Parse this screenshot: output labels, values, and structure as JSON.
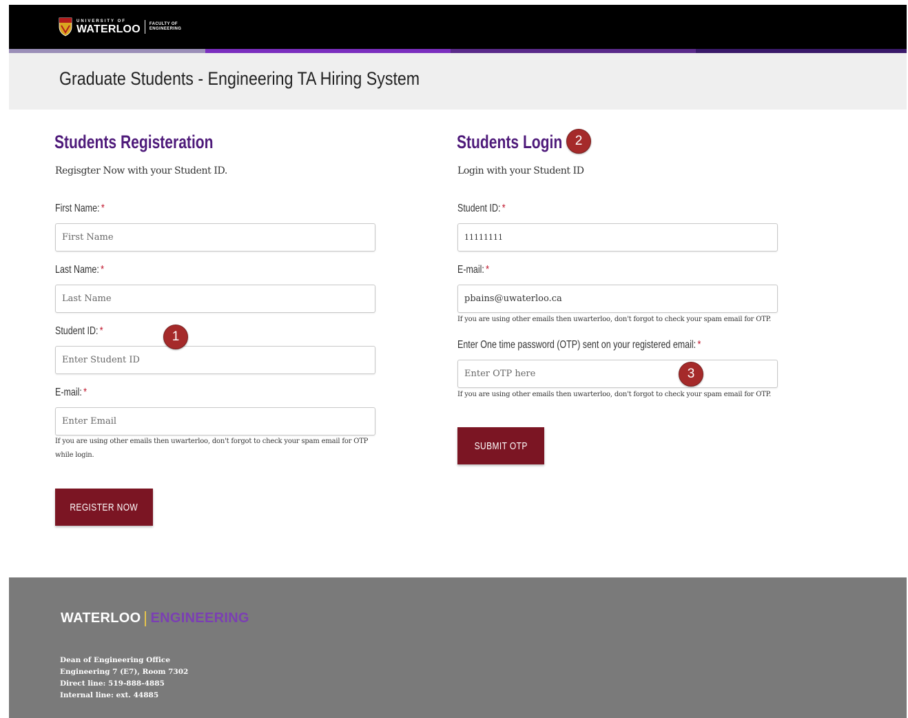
{
  "header": {
    "logo_university_small": "UNIVERSITY OF",
    "logo_university": "WATERLOO",
    "logo_faculty_line1": "FACULTY OF",
    "logo_faculty_line2": "ENGINEERING",
    "page_title": "Graduate Students - Engineering TA Hiring System",
    "stripe_colors": [
      "#9b8fb8",
      "#7b2fbf",
      "#5a2a8a",
      "#3a1a6a"
    ]
  },
  "registration": {
    "title": "Students Registeration",
    "subtitle": "Regisgter Now with your Student ID.",
    "first_name": {
      "label": "First Name:",
      "placeholder": "First Name"
    },
    "last_name": {
      "label": "Last Name:",
      "placeholder": "Last Name"
    },
    "student_id": {
      "label": "Student ID:",
      "placeholder": "Enter Student ID"
    },
    "email": {
      "label": "E-mail:",
      "placeholder": "Enter Email"
    },
    "hint_line1": "If you are using other emails then uwarterloo, don't forgot to check your spam email for OTP",
    "hint_line2": "while login.",
    "button": "REGISTER NOW"
  },
  "login": {
    "title": "Students Login",
    "subtitle": "Login with your Student ID",
    "student_id": {
      "label": "Student ID:",
      "value": "11111111"
    },
    "email": {
      "label": "E-mail:",
      "value": "pbains@uwaterloo.ca"
    },
    "email_hint": "If you are using other emails then uwarterloo, don't forgot to check your spam email for OTP.",
    "otp": {
      "label": "Enter One time password (OTP) sent on your registered email:",
      "placeholder": "Enter OTP here"
    },
    "otp_hint": "If you are using other emails then uwarterloo, don't forgot to check your spam email for OTP.",
    "button": "SUBMIT OTP"
  },
  "required_marker": "*",
  "annotations": {
    "badge1": "1",
    "badge2": "2",
    "badge3": "3",
    "color": "#a52a2a"
  },
  "footer": {
    "logo_left": "WATERLOO",
    "logo_right": "ENGINEERING",
    "address": [
      "Dean of Engineering Office",
      "Engineering 7 (E7), Room 7302",
      "Direct line: 519-888-4885",
      "Internal line: ext. 44885"
    ]
  },
  "colors": {
    "accent": "#7b1523",
    "heading": "#4e1a7a",
    "footer_bg": "#7a7a7a"
  }
}
